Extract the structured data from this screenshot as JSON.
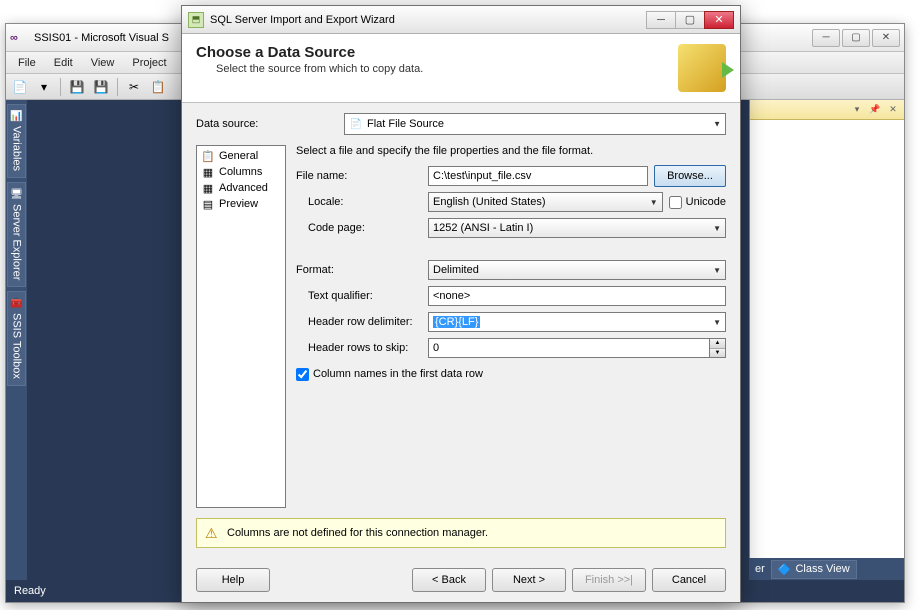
{
  "vs": {
    "title": "SSIS01 - Microsoft Visual S",
    "menus": [
      "File",
      "Edit",
      "View",
      "Project"
    ],
    "sidebar": [
      "Variables",
      "Server Explorer",
      "SSIS Toolbox"
    ],
    "status": "Ready",
    "rightBottom": {
      "er": "er",
      "classView": "Class View"
    }
  },
  "wizard": {
    "title": "SQL Server Import and Export Wizard",
    "heading": "Choose a Data Source",
    "subheading": "Select the source from which to copy data.",
    "dataSourceLabel": "Data source:",
    "dataSourceValue": "Flat File Source",
    "nav": {
      "general": "General",
      "columns": "Columns",
      "advanced": "Advanced",
      "preview": "Preview"
    },
    "instruction": "Select a file and specify the file properties and the file format.",
    "labels": {
      "fileName": "File name:",
      "locale": "Locale:",
      "unicode": "Unicode",
      "codePage": "Code page:",
      "format": "Format:",
      "textQualifier": "Text qualifier:",
      "headerDelim": "Header row delimiter:",
      "headerSkip": "Header rows to skip:",
      "colNames": "Column names in the first data row"
    },
    "values": {
      "fileName": "C:\\test\\input_file.csv",
      "locale": "English (United States)",
      "codePage": "1252  (ANSI - Latin I)",
      "format": "Delimited",
      "textQualifier": "<none>",
      "headerDelim": "{CR}{LF}",
      "headerSkip": "0",
      "unicodeChecked": false,
      "colNamesChecked": true
    },
    "browse": "Browse...",
    "warning": "Columns are not defined for this connection manager.",
    "buttons": {
      "help": "Help",
      "back": "< Back",
      "next": "Next >",
      "finish": "Finish >>|",
      "cancel": "Cancel"
    }
  }
}
